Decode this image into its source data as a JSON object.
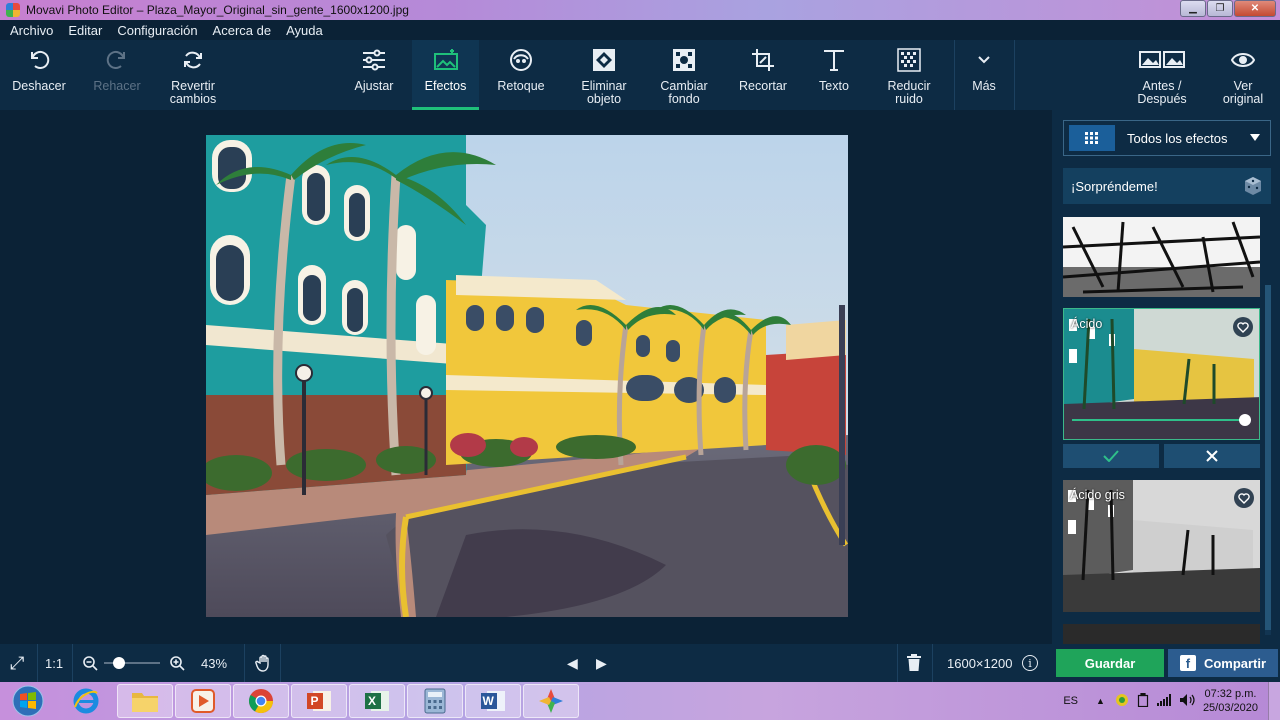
{
  "window": {
    "title": "Movavi Photo Editor – Plaza_Mayor_Original_sin_gente_1600x1200.jpg",
    "minimize": "▁",
    "maximize": "❐",
    "close": "✕"
  },
  "menu": [
    "Archivo",
    "Editar",
    "Configuración",
    "Acerca de",
    "Ayuda"
  ],
  "toolbar": {
    "undo": "Deshacer",
    "redo": "Rehacer",
    "revert": "Revertir\ncambios",
    "adjust": "Ajustar",
    "effects": "Efectos",
    "retouch": "Retoque",
    "remove_object": "Eliminar\nobjeto",
    "change_bg": "Cambiar\nfondo",
    "crop": "Recortar",
    "text": "Texto",
    "denoise": "Reducir\nruido",
    "more": "Más",
    "before_after": "Antes /\nDespués",
    "view_original": "Ver\noriginal"
  },
  "panel": {
    "effects_dropdown": "Todos los efectos",
    "surprise": "¡Sorpréndeme!",
    "effects": [
      {
        "name": ""
      },
      {
        "name": "Ácido",
        "selected": true,
        "strength": 0.97
      },
      {
        "name": "Ácido gris"
      }
    ],
    "apply_icon": "✓",
    "cancel_icon": "✕"
  },
  "status": {
    "fit_icon": "⤢",
    "one_to_one": "1:1",
    "zoom_value": 0.2,
    "zoom_percent": "43%",
    "prev": "◀",
    "next": "▶",
    "image_size": "1600×1200",
    "info": "i",
    "save": "Guardar",
    "share": "Compartir"
  },
  "taskbar": {
    "language": "ES",
    "time": "07:32 p.m.",
    "date": "25/03/2020"
  },
  "colors": {
    "bg": "#0b2236",
    "toolbar": "#0d2b44",
    "accent_green": "#1fa45a",
    "share_blue": "#2c5c8f",
    "active_underline": "#1fc07a"
  }
}
